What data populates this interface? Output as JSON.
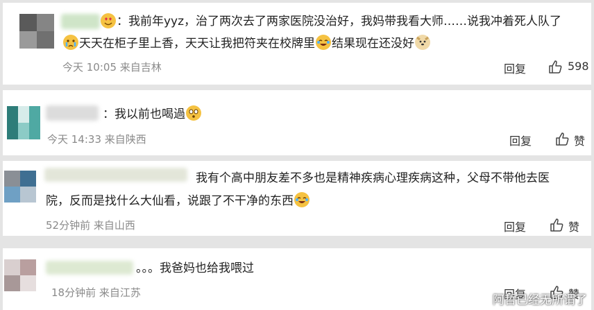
{
  "comments": [
    {
      "text_line1": "：我前年yyz，治了两次去了两家医院没治好，我妈带我看大师……说我冲着死人队了",
      "text_line2_a": "天天在柜子里上香，天天让我把符夹在校牌里",
      "text_line2_b": "结果现在还没好",
      "time": "今天 10:05",
      "location": "来自吉林",
      "reply_label": "回复",
      "like_label": "598"
    },
    {
      "text_line1": "：我以前也喝過",
      "time": "今天 14:33",
      "location": "来自陕西",
      "reply_label": "回复",
      "like_label": "赞"
    },
    {
      "text_line1": "我有个高中朋友差不多也是精神疾病心理疾病这种，父母不带他去医",
      "text_line2": "院，反而是找什么大仙看，说跟了不干净的东西",
      "time": "52分钟前",
      "location": "来自山西",
      "reply_label": "回复",
      "like_label": "赞"
    },
    {
      "text_line1": "。。。我爸妈也给我喂过",
      "time": "18分钟前",
      "location": "来自江苏",
      "reply_label": "回复",
      "like_label": "赞"
    }
  ],
  "watermark": "阿哲已经无所谓了",
  "colors": {
    "background": "#e4e4e4",
    "card": "#ffffff",
    "meta": "#8a8a8a"
  }
}
